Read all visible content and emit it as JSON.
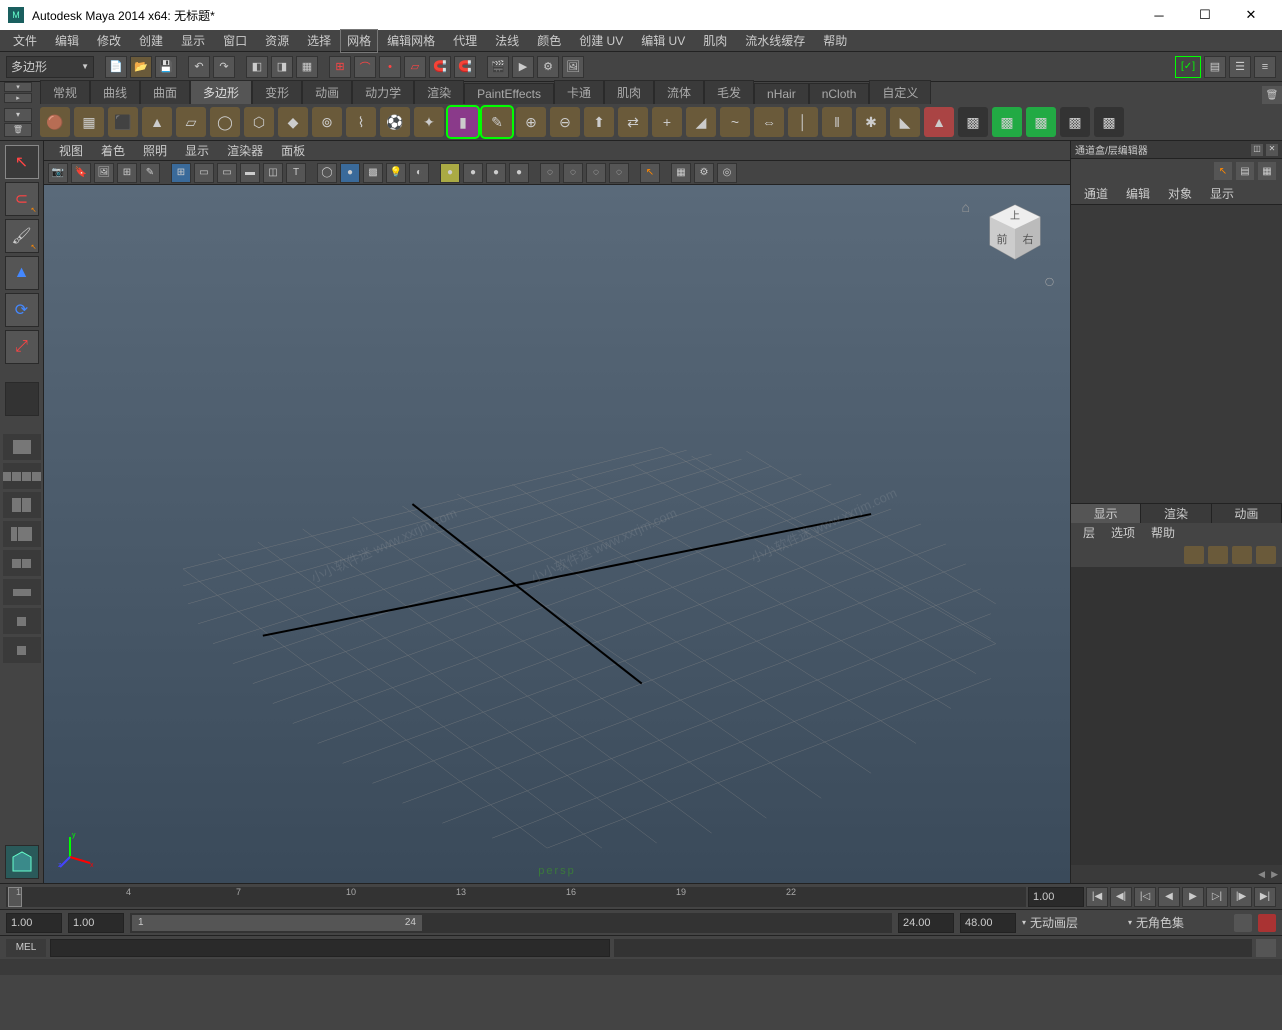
{
  "title": "Autodesk Maya 2014 x64: 无标题*",
  "menubar": [
    "文件",
    "编辑",
    "修改",
    "创建",
    "显示",
    "窗口",
    "资源",
    "选择",
    "网格",
    "编辑网格",
    "代理",
    "法线",
    "颜色",
    "创建 UV",
    "编辑 UV",
    "肌肉",
    "流水线缓存",
    "帮助"
  ],
  "menubar_boxed_index": 8,
  "module_combo": "多边形",
  "shelves": [
    "常规",
    "曲线",
    "曲面",
    "多边形",
    "变形",
    "动画",
    "动力学",
    "渲染",
    "PaintEffects",
    "卡通",
    "肌肉",
    "流体",
    "毛发",
    "nHair",
    "nCloth",
    "自定义"
  ],
  "shelf_active_index": 3,
  "panel_menu": [
    "视图",
    "着色",
    "照明",
    "显示",
    "渲染器",
    "面板"
  ],
  "viewcube_faces": {
    "top": "上",
    "front": "前",
    "right": "右"
  },
  "persp_label": "persp",
  "channel_box_title": "通道盒/层编辑器",
  "channel_menu": [
    "通道",
    "编辑",
    "对象",
    "显示"
  ],
  "layer_tabs": [
    "显示",
    "渲染",
    "动画"
  ],
  "layer_tab_active": 0,
  "layer_menu": [
    "层",
    "选项",
    "帮助"
  ],
  "timeline": {
    "ticks": [
      "1",
      "48",
      "96",
      "144",
      "192",
      "240",
      "288",
      "336",
      "384",
      "432",
      "480",
      "528",
      "576",
      "624",
      "672",
      "720",
      "768",
      "816",
      "864",
      "912"
    ],
    "tick_labels": [
      "1",
      "4",
      "7",
      "10",
      "13",
      "16",
      "19",
      "22"
    ],
    "current": "1.00"
  },
  "range": {
    "start": "1.00",
    "in": "1.00",
    "range_start": "1",
    "range_end": "24",
    "out": "24.00",
    "end": "48.00"
  },
  "anim_layer": "无动画层",
  "char_set": "无角色集",
  "cmd_lang": "MEL",
  "watermarks": [
    "小小软件迷 www.xxrjm.com",
    "小小软件迷 www.xxrjm.com",
    "小小软件迷 www.xxrjm.com"
  ]
}
